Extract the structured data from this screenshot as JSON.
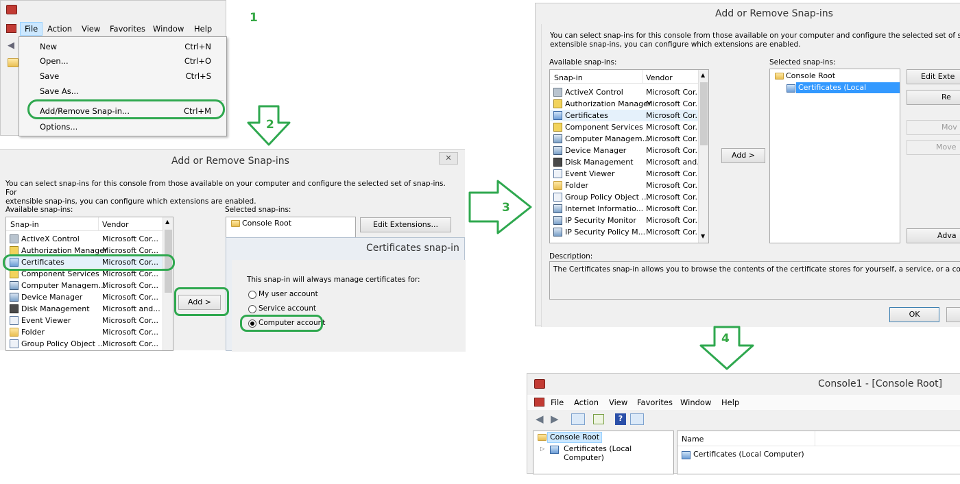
{
  "steps": [
    "1",
    "2",
    "3",
    "4"
  ],
  "panel1": {
    "menu": [
      "File",
      "Action",
      "View",
      "Favorites",
      "Window",
      "Help"
    ],
    "items": [
      {
        "label": "New",
        "shortcut": "Ctrl+N"
      },
      {
        "label": "Open...",
        "shortcut": "Ctrl+O"
      },
      {
        "label": "Save",
        "shortcut": "Ctrl+S"
      },
      {
        "label": "Save As...",
        "shortcut": ""
      },
      {
        "label": "Add/Remove Snap-in...",
        "shortcut": "Ctrl+M"
      },
      {
        "label": "Options...",
        "shortcut": ""
      }
    ]
  },
  "panel2": {
    "title": "Add or Remove Snap-ins",
    "close": "✕",
    "description_line1": "You can select snap-ins for this console from those available on your computer and configure the selected set of snap-ins. For",
    "description_line2": "extensible snap-ins, you can configure which extensions are enabled.",
    "available_label": "Available snap-ins:",
    "selected_label": "Selected snap-ins:",
    "col_snapin": "Snap-in",
    "col_vendor": "Vendor",
    "rows": [
      {
        "name": "ActiveX Control",
        "vendor": "Microsoft Cor...",
        "icon": "gear"
      },
      {
        "name": "Authorization Manager",
        "vendor": "Microsoft Cor...",
        "icon": "yel"
      },
      {
        "name": "Certificates",
        "vendor": "Microsoft Cor...",
        "icon": "cert"
      },
      {
        "name": "Component Services",
        "vendor": "Microsoft Cor...",
        "icon": "yel"
      },
      {
        "name": "Computer Managem...",
        "vendor": "Microsoft Cor...",
        "icon": "pc"
      },
      {
        "name": "Device Manager",
        "vendor": "Microsoft Cor...",
        "icon": "pc"
      },
      {
        "name": "Disk Management",
        "vendor": "Microsoft and...",
        "icon": "dark"
      },
      {
        "name": "Event Viewer",
        "vendor": "Microsoft Cor...",
        "icon": "bluedoc"
      },
      {
        "name": "Folder",
        "vendor": "Microsoft Cor...",
        "icon": "folder"
      },
      {
        "name": "Group Policy Object ...",
        "vendor": "Microsoft Cor...",
        "icon": "bluedoc"
      }
    ],
    "selected_root": "Console Root",
    "edit_extensions": "Edit Extensions...",
    "add_button": "Add >",
    "cert_dialog": {
      "title": "Certificates snap-in",
      "prompt": "This snap-in will always manage certificates for:",
      "options": [
        "My user account",
        "Service account",
        "Computer account"
      ],
      "selected_index": 2
    }
  },
  "panel3": {
    "title": "Add or Remove Snap-ins",
    "description_line1": "You can select snap-ins for this console from those available on your computer and configure the selected set of snap-ins. For",
    "description_line2": "extensible snap-ins, you can configure which extensions are enabled.",
    "available_label": "Available snap-ins:",
    "selected_label": "Selected snap-ins:",
    "col_snapin": "Snap-in",
    "col_vendor": "Vendor",
    "rows": [
      {
        "name": "ActiveX Control",
        "vendor": "Microsoft Cor...",
        "icon": "gear"
      },
      {
        "name": "Authorization Manager",
        "vendor": "Microsoft Cor...",
        "icon": "yel"
      },
      {
        "name": "Certificates",
        "vendor": "Microsoft Cor...",
        "icon": "cert"
      },
      {
        "name": "Component Services",
        "vendor": "Microsoft Cor...",
        "icon": "yel"
      },
      {
        "name": "Computer Managem...",
        "vendor": "Microsoft Cor...",
        "icon": "pc"
      },
      {
        "name": "Device Manager",
        "vendor": "Microsoft Cor...",
        "icon": "pc"
      },
      {
        "name": "Disk Management",
        "vendor": "Microsoft and...",
        "icon": "dark"
      },
      {
        "name": "Event Viewer",
        "vendor": "Microsoft Cor...",
        "icon": "bluedoc"
      },
      {
        "name": "Folder",
        "vendor": "Microsoft Cor...",
        "icon": "folder"
      },
      {
        "name": "Group Policy Object ...",
        "vendor": "Microsoft Cor...",
        "icon": "bluedoc"
      },
      {
        "name": "Internet Informatio...",
        "vendor": "Microsoft Cor...",
        "icon": "pc"
      },
      {
        "name": "IP Security Monitor",
        "vendor": "Microsoft Cor...",
        "icon": "pc"
      },
      {
        "name": "IP Security Policy M...",
        "vendor": "Microsoft Cor...",
        "icon": "pc"
      }
    ],
    "add_button": "Add >",
    "tree_root": "Console Root",
    "tree_child": "Certificates (Local Computer)",
    "buttons": [
      "Edit Exte",
      "Re",
      "Mov",
      "Move",
      "Adva"
    ],
    "description_label": "Description:",
    "description_text": "The Certificates snap-in allows you to browse the contents of the certificate stores for yourself, a service, or a compute",
    "ok": "OK"
  },
  "panel4": {
    "title": "Console1 - [Console Root]",
    "menu": [
      "File",
      "Action",
      "View",
      "Favorites",
      "Window",
      "Help"
    ],
    "tree_root": "Console Root",
    "tree_child": "Certificates (Local Computer)",
    "col_name": "Name",
    "list_item": "Certificates (Local Computer)"
  },
  "colors": {
    "highlight": "#cce8ff",
    "select_blue": "#3399ff",
    "green": "#2fa84f",
    "arrow_stroke": "#2fa84f"
  }
}
